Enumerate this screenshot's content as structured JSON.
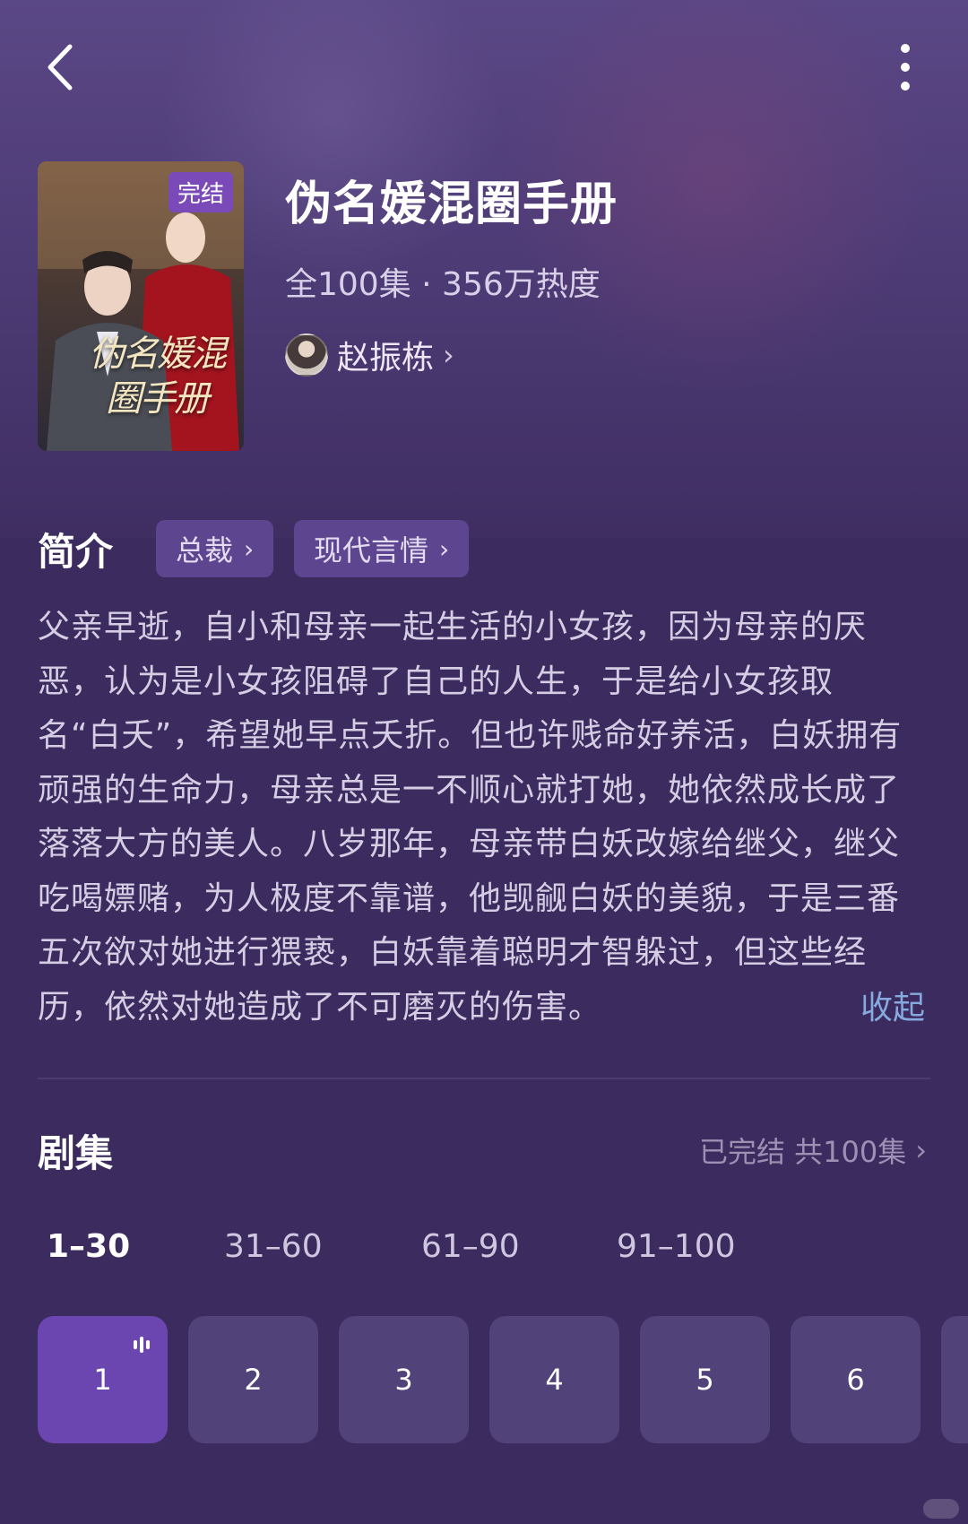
{
  "nav": {
    "back_icon": "chevron-left-icon",
    "more_icon": "more-vertical-icon"
  },
  "drama": {
    "cover_badge": "完结",
    "cover_title": "伪名媛混圈手册",
    "title": "伪名媛混圈手册",
    "meta": "全100集 · 356万热度",
    "author": "赵振栋",
    "author_chevron": "›"
  },
  "intro": {
    "heading": "简介",
    "tags": [
      {
        "label": "总裁",
        "chevron": "›"
      },
      {
        "label": "现代言情",
        "chevron": "›"
      }
    ],
    "text": "父亲早逝，自小和母亲一起生活的小女孩，因为母亲的厌恶，认为是小女孩阻碍了自己的人生，于是给小女孩取名“白夭”，希望她早点夭折。但也许贱命好养活，白妖拥有顽强的生命力，母亲总是一不顺心就打她，她依然成长成了落落大方的美人。八岁那年，母亲带白妖改嫁给继父，继父吃喝嫖赌，为人极度不靠谱，他觊觎白妖的美貌，于是三番五次欲对她进行猥亵，白妖靠着聪明才智躲过，但这些经历，依然对她造成了不可磨灭的伤害。",
    "collapse": "收起"
  },
  "episodes": {
    "heading": "剧集",
    "status": "已完结 共100集",
    "status_chevron": "›",
    "ranges": [
      "1–30",
      "31–60",
      "61–90",
      "91–100"
    ],
    "active_range": 0,
    "items": [
      "1",
      "2",
      "3",
      "4",
      "5",
      "6"
    ],
    "active_item": 0,
    "playing_icon": "sound-bars-icon"
  },
  "colors": {
    "background": "#3c2b5e",
    "accent": "#6b46b0",
    "tag_bg": "#5d468f",
    "link": "#86a9de"
  }
}
